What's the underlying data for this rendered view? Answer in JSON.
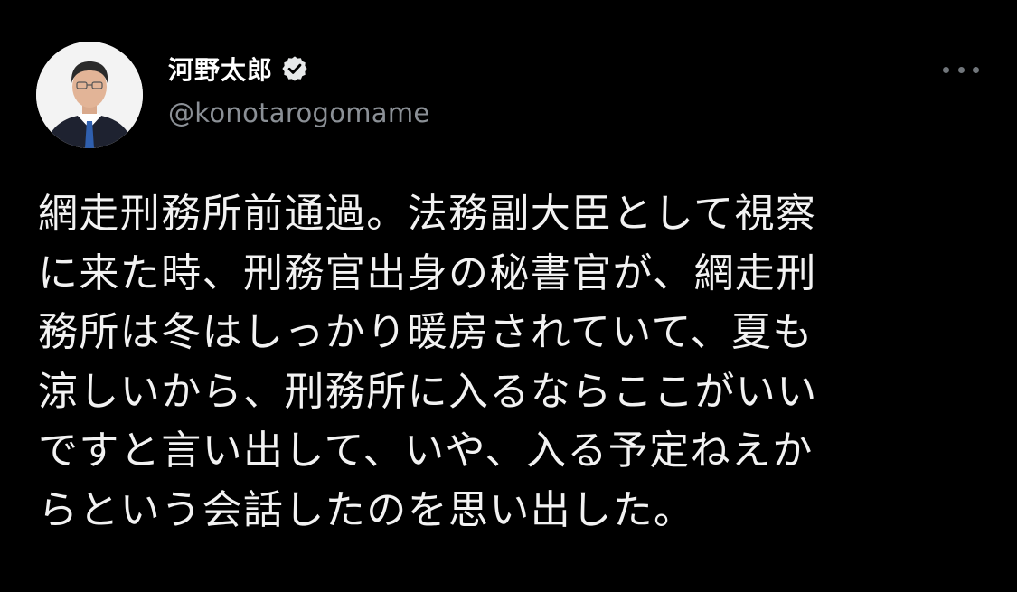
{
  "tweet": {
    "author": {
      "display_name": "河野太郎",
      "handle": "@konotarogomame",
      "verified": true
    },
    "icons": {
      "verified": "verified-badge-icon",
      "more": "more-options-icon"
    },
    "text_lines": [
      "網走刑務所前通過。法務副大臣として視察",
      "に来た時、刑務官出身の秘書官が、網走刑",
      "務所は冬はしっかり暖房されていて、夏も",
      "涼しいから、刑務所に入るならここがいい",
      "ですと言い出して、いや、入る予定ねえか",
      "らという会話したのを思い出した。"
    ],
    "colors": {
      "background": "#000000",
      "text": "#f2f2f2",
      "handle": "#8b9096",
      "icon_gray": "#71767b"
    }
  }
}
